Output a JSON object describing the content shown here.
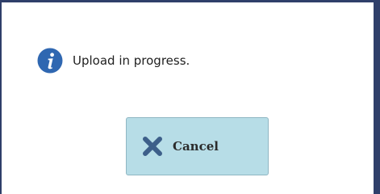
{
  "dialog": {
    "message": "Upload in progress.",
    "info_icon": "info-icon",
    "cancel_button": {
      "label": "Cancel",
      "icon": "close-x-icon"
    }
  },
  "colors": {
    "frame": "#2f3f6a",
    "info_icon_fill": "#2f67b1",
    "button_background": "#b7dde7",
    "button_border": "#8fb6c3",
    "x_icon": "#3d5f8a"
  }
}
